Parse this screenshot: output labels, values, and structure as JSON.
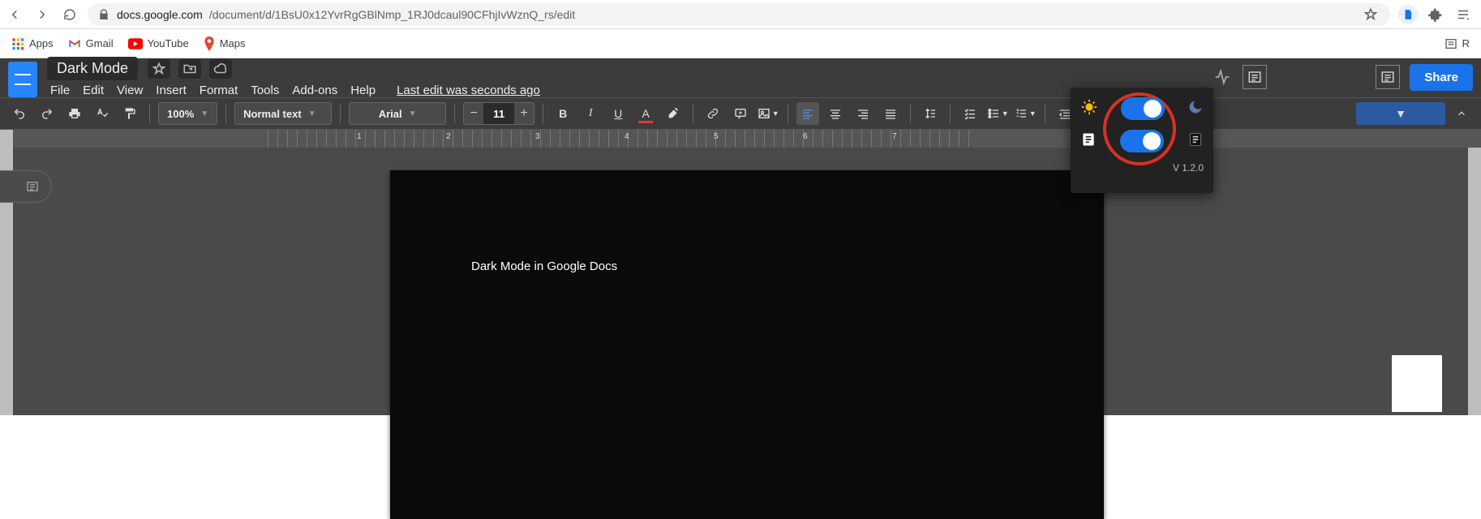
{
  "browser": {
    "url_host": "docs.google.com",
    "url_path": "/document/d/1BsU0x12YvrRgGBlNmp_1RJ0dcaul90CFhjIvWznQ_rs/edit"
  },
  "bookmarks": {
    "apps": "Apps",
    "gmail": "Gmail",
    "youtube": "YouTube",
    "maps": "Maps",
    "reading_list": "R"
  },
  "doc": {
    "title": "Dark Mode",
    "menus": {
      "file": "File",
      "edit": "Edit",
      "view": "View",
      "insert": "Insert",
      "format": "Format",
      "tools": "Tools",
      "addons": "Add-ons",
      "help": "Help"
    },
    "last_edit": "Last edit was seconds ago",
    "share": "Share"
  },
  "toolbar": {
    "zoom": "100%",
    "style": "Normal text",
    "font": "Arial",
    "size": "11"
  },
  "page": {
    "text": "Dark Mode in Google Docs"
  },
  "ruler": {
    "n1": "1",
    "n2": "2",
    "n3": "3",
    "n4": "4",
    "n5": "5",
    "n6": "6",
    "n7": "7"
  },
  "extension": {
    "version": "V 1.2.0"
  }
}
